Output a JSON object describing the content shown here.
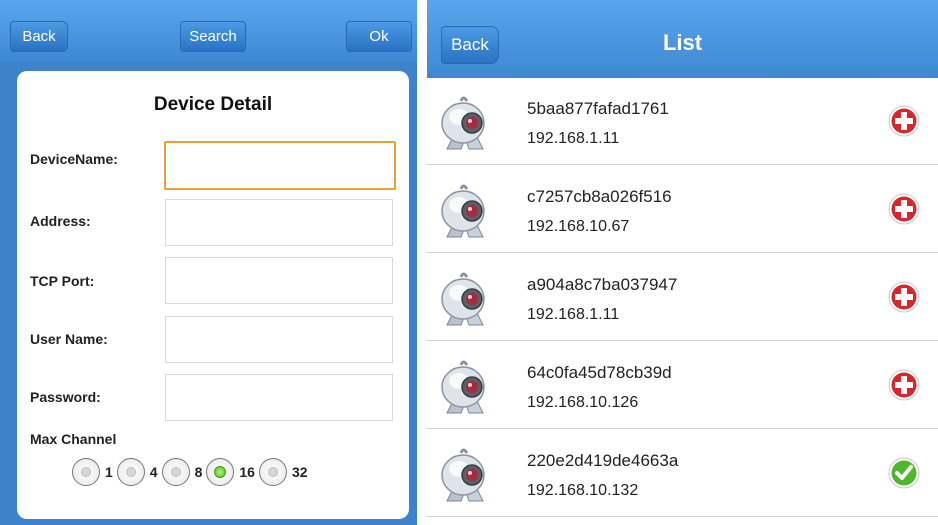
{
  "detail": {
    "back_label": "Back",
    "search_label": "Search",
    "ok_label": "Ok",
    "title": "Device Detail",
    "fields": {
      "device_name": {
        "label": "DeviceName:",
        "value": ""
      },
      "address": {
        "label": "Address:",
        "value": ""
      },
      "tcp_port": {
        "label": "TCP Port:",
        "value": ""
      },
      "user_name": {
        "label": "User Name:",
        "value": ""
      },
      "password": {
        "label": "Password:",
        "value": ""
      }
    },
    "max_channel_label": "Max Channel",
    "channels": [
      "1",
      "4",
      "8",
      "16",
      "32"
    ],
    "selected_channel": "16"
  },
  "list": {
    "back_label": "Back",
    "title": "List",
    "items": [
      {
        "name": "5baa877fafad1761",
        "ip": "192.168.1.11",
        "status": "add"
      },
      {
        "name": "c7257cb8a026f516",
        "ip": "192.168.10.67",
        "status": "add"
      },
      {
        "name": "a904a8c7ba037947",
        "ip": "192.168.1.11",
        "status": "add"
      },
      {
        "name": "64c0fa45d78cb39d",
        "ip": "192.168.10.126",
        "status": "add"
      },
      {
        "name": "220e2d419de4663a",
        "ip": "192.168.10.132",
        "status": "added"
      }
    ]
  },
  "colors": {
    "title_bar": "#4a97e0",
    "focus_border": "#f0a030",
    "add_icon": "#d9262a",
    "check_icon": "#4fb82a"
  }
}
